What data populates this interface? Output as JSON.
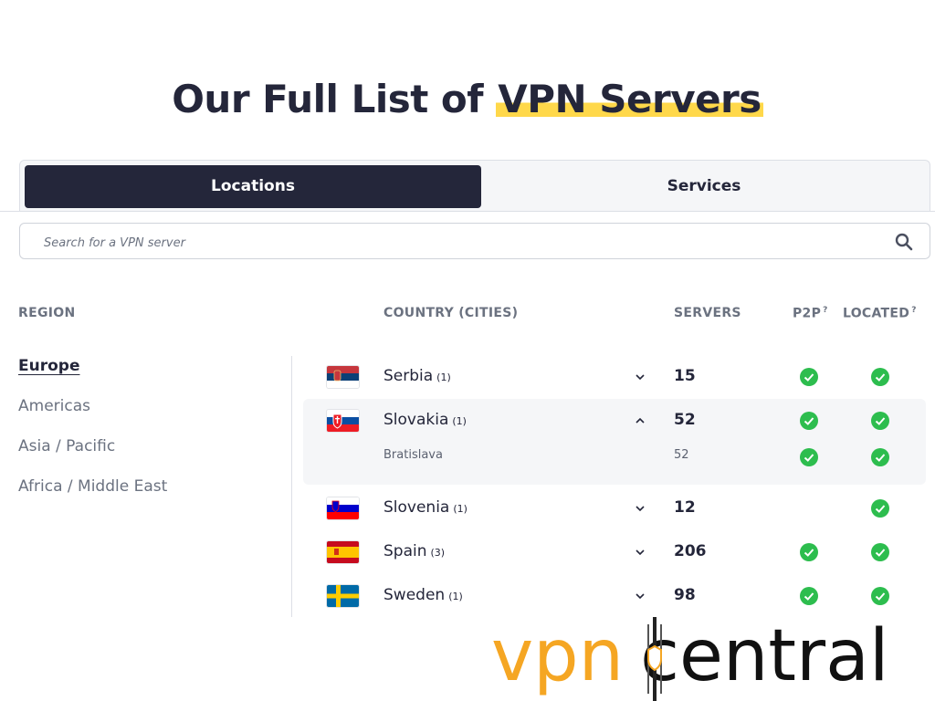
{
  "title": {
    "prefix": "Our Full List of ",
    "highlight": "VPN Servers"
  },
  "tabs": [
    {
      "label": "Locations",
      "active": true
    },
    {
      "label": "Services",
      "active": false
    }
  ],
  "search": {
    "placeholder": "Search for a VPN server",
    "value": "",
    "icon": "search-icon"
  },
  "headers": {
    "region": "REGION",
    "country": "COUNTRY (CITIES)",
    "servers": "SERVERS",
    "p2p": "P2P",
    "located": "LOCATED",
    "help_mark": "?"
  },
  "regions": [
    "Europe",
    "Americas",
    "Asia / Pacific",
    "Africa / Middle East"
  ],
  "active_region": "Europe",
  "countries": [
    {
      "name": "Serbia",
      "cities": "(1)",
      "servers": "15",
      "p2p": true,
      "located": true,
      "expanded": false
    },
    {
      "name": "Slovakia",
      "cities": "(1)",
      "servers": "52",
      "p2p": true,
      "located": true,
      "expanded": true,
      "city_list": [
        {
          "name": "Bratislava",
          "servers": "52",
          "p2p": true,
          "located": true
        }
      ]
    },
    {
      "name": "Slovenia",
      "cities": "(1)",
      "servers": "12",
      "p2p": false,
      "located": true,
      "expanded": false
    },
    {
      "name": "Spain",
      "cities": "(3)",
      "servers": "206",
      "p2p": true,
      "located": true,
      "expanded": false
    },
    {
      "name": "Sweden",
      "cities": "(1)",
      "servers": "98",
      "p2p": true,
      "located": true,
      "expanded": false
    }
  ],
  "logo": {
    "part1": "vpn",
    "part2": "central"
  },
  "colors": {
    "dark": "#24263a",
    "highlight": "#ffd84a",
    "check": "#2dbd4e",
    "muted": "#6b7280",
    "logo_orange": "#f5a623"
  }
}
